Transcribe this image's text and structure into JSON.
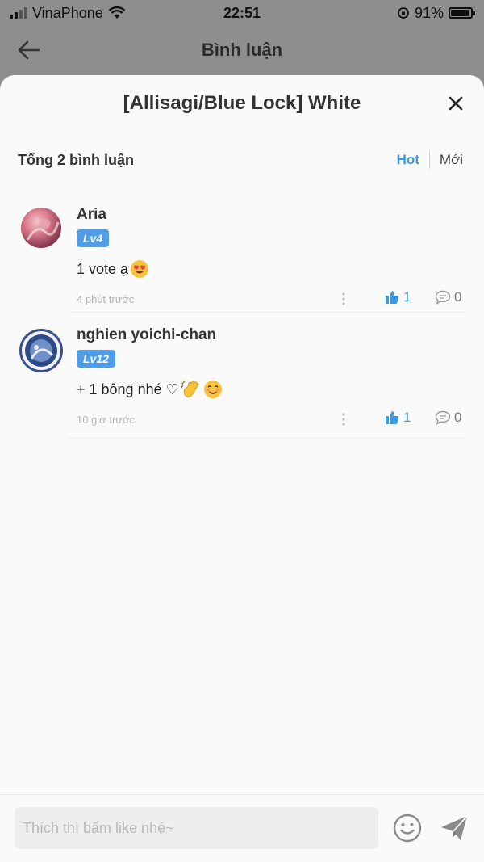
{
  "status_bar": {
    "carrier": "VinaPhone",
    "time": "22:51",
    "battery_percent": "91%",
    "battery_level": 0.91
  },
  "nav": {
    "title": "Bình luận",
    "back_icon": "arrow-left-icon"
  },
  "sheet": {
    "title": "[Allisagi/Blue Lock] White",
    "close_icon": "close-icon",
    "summary": "Tổng 2 bình luận",
    "tabs": [
      {
        "label": "Hot",
        "active": true
      },
      {
        "label": "Mới",
        "active": false
      }
    ]
  },
  "comments": [
    {
      "name": "Aria",
      "level": "Lv4",
      "text": "1 vote ạ",
      "emojis": [
        "heart-eyes-emoji"
      ],
      "time": "4 phút trước",
      "likes": "1",
      "replies": "0"
    },
    {
      "name": "nghien yoichi-chan",
      "level": "Lv12",
      "text": "+ 1 bông nhé ♡",
      "emojis": [
        "waving-hand-emoji",
        "smiling-face-emoji"
      ],
      "time": "10 giờ trước",
      "likes": "1",
      "replies": "0"
    }
  ],
  "input_bar": {
    "placeholder": "Thích thì bấm like nhé~",
    "emoji_icon": "smiley-icon",
    "send_icon": "send-icon"
  },
  "colors": {
    "accent": "#3a9ae0",
    "badge": "#4f9de8",
    "overlay": "#8e8e8e"
  }
}
